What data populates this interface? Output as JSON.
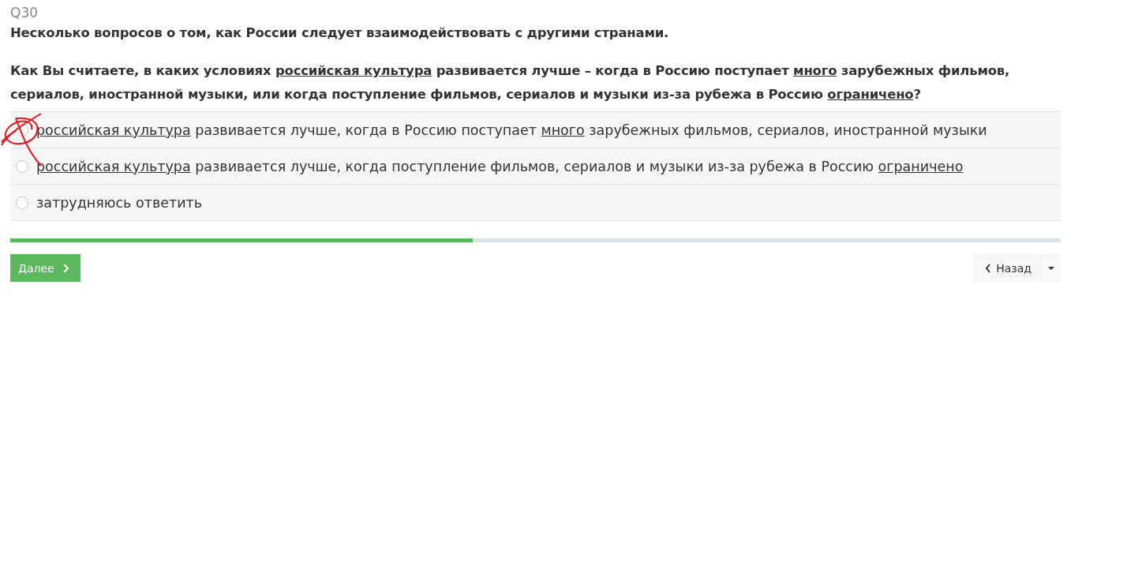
{
  "question": {
    "number": "Q30",
    "intro": "Несколько вопросов о том, как России следует взаимодействовать с другими странами.",
    "text": [
      {
        "text": "Как Вы считаете, в каких условиях ",
        "underline": false
      },
      {
        "text": "российская культура",
        "underline": true
      },
      {
        "text": " развивается лучше – когда в Россию поступает ",
        "underline": false
      },
      {
        "text": "много",
        "underline": true
      },
      {
        "text": " зарубежных фильмов, сериалов, иностранной музыки, или когда поступление фильмов, сериалов и музыки из-за рубежа в Россию ",
        "underline": false
      },
      {
        "text": "ограничено",
        "underline": true
      },
      {
        "text": "?",
        "underline": false
      }
    ]
  },
  "options": [
    {
      "selected": false,
      "label": [
        {
          "text": "российская культура",
          "underline": true
        },
        {
          "text": " развивается лучше, когда в Россию поступает ",
          "underline": false
        },
        {
          "text": "много",
          "underline": true
        },
        {
          "text": " зарубежных фильмов, сериалов, иностранной музыки",
          "underline": false
        }
      ]
    },
    {
      "selected": false,
      "label": [
        {
          "text": "российская культура",
          "underline": true
        },
        {
          "text": " развивается лучше, когда поступление фильмов, сериалов и музыки из-за рубежа в Россию ",
          "underline": false
        },
        {
          "text": "ограничено",
          "underline": true
        }
      ]
    },
    {
      "selected": false,
      "label": [
        {
          "text": "затрудняюсь ответить",
          "underline": false
        }
      ]
    }
  ],
  "progress": {
    "level": 0.44
  },
  "buttons": {
    "next": "Далее",
    "back": "Назад"
  }
}
